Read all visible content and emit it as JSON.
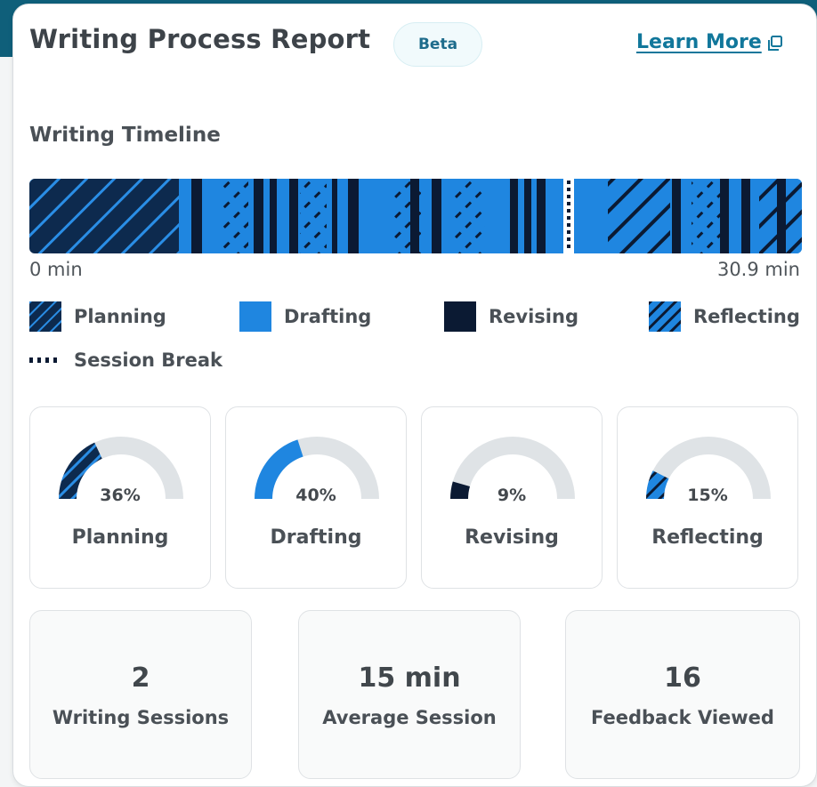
{
  "header": {
    "title": "Writing Process Report",
    "badge": "Beta",
    "learn_more": "Learn More",
    "link_icon": "external-link-icon"
  },
  "timeline": {
    "title": "Writing Timeline",
    "start_label": "0 min",
    "end_label": "30.9 min",
    "total_minutes": 30.9,
    "session_break_minute": 18.6
  },
  "legend": {
    "planning": "Planning",
    "drafting": "Drafting",
    "revising": "Revising",
    "reflecting": "Reflecting",
    "session_break": "Session Break"
  },
  "stats": [
    {
      "percent_label": "36%",
      "label": "Planning",
      "value": 36,
      "kind": "planning"
    },
    {
      "percent_label": "40%",
      "label": "Drafting",
      "value": 40,
      "kind": "drafting"
    },
    {
      "percent_label": "9%",
      "label": "Revising",
      "value": 9,
      "kind": "revising"
    },
    {
      "percent_label": "15%",
      "label": "Reflecting",
      "value": 15,
      "kind": "reflecting"
    }
  ],
  "summary": [
    {
      "value": "2",
      "label": "Writing Sessions"
    },
    {
      "value": "15 min",
      "label": "Average Session"
    },
    {
      "value": "16",
      "label": "Feedback Viewed"
    }
  ],
  "colors": {
    "drafting": "#1f86e0",
    "revising": "#0b1a33",
    "planning_bg": "#0d2a4e",
    "planning_stripe": "#2a8ee6",
    "reflecting_bg": "#1f86e0",
    "reflecting_stripe": "#0b1a33",
    "gauge_track": "#dfe3e6",
    "accent_link": "#11779b"
  }
}
